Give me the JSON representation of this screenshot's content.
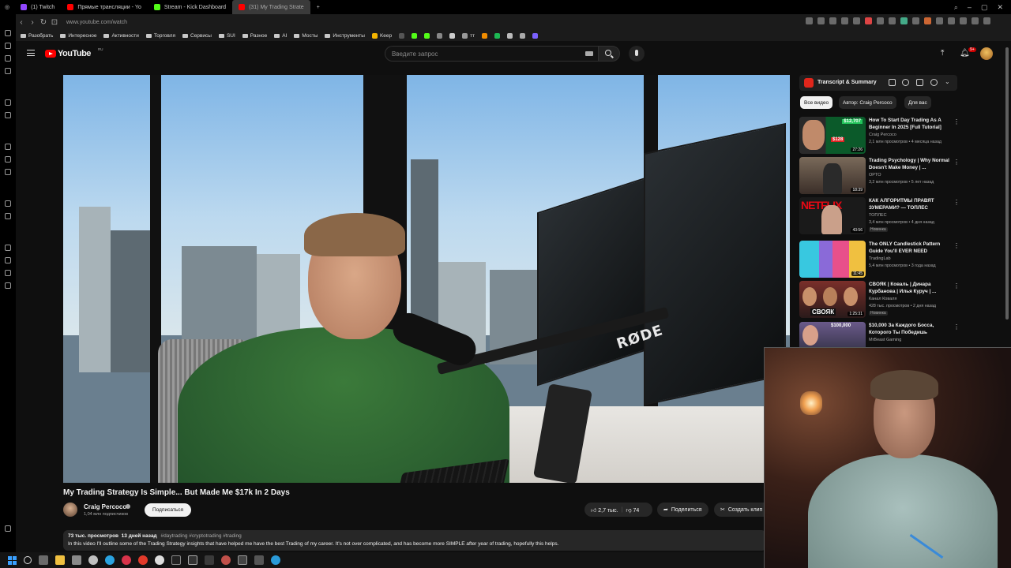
{
  "browser": {
    "tabs": [
      {
        "label": "(1) Twitch",
        "color": "#9146ff",
        "active": false
      },
      {
        "label": "Прямые трансляции - Yo",
        "color": "#ff0000",
        "active": false
      },
      {
        "label": "Stream - Kick Dashboard",
        "color": "#53fc18",
        "active": false
      },
      {
        "label": "(31) My Trading Strate",
        "color": "#ff0000",
        "active": true
      }
    ],
    "url": "www.youtube.com/watch",
    "bookmarks": [
      "Разобрать",
      "Интересное",
      "Активности",
      "Торговля",
      "Сервисы",
      "SUI",
      "Разное",
      "AI",
      "Мосты",
      "Инструменты",
      "Keep",
      "тт"
    ]
  },
  "youtube": {
    "brand": "YouTube",
    "region": "RU",
    "search_placeholder": "Введите запрос",
    "notifications": "9+"
  },
  "video": {
    "title": "My Trading Strategy Is Simple... But Made Me $17k In 2 Days",
    "channel": "Craig Percoco",
    "subscribers": "1,04 млн подписчиков",
    "subscribe_label": "Подписаться",
    "likes": "2,7 тыс.",
    "dislikes": "74",
    "share_label": "Поделиться",
    "clip_label": "Создать клип",
    "views": "73 тыс. просмотров",
    "age": "13 дней назад",
    "tags": "#daytrading #cryptotrading #trading",
    "description": "In this video I'll outline some of the Trading Strategy insights that have helped me have the best Trading of my career. It's not over complicated, and has become more SIMPLE after year of trading, hopefully this helps.",
    "overlay_text": "RØDE"
  },
  "sidebar_panel": {
    "transcript_label": "Transcript & Summary",
    "chips": [
      "Все видео",
      "Автор: Craig Percoco",
      "Для вас"
    ],
    "recommendations": [
      {
        "title": "How To Start Day Trading As A Beginner In 2025 [Full Tutorial]",
        "channel": "Craig Percoco",
        "meta": "2,1 млн просмотров • 4 месяца назад",
        "duration": "27:26",
        "badge": "",
        "thumb_overlay": "$12,707",
        "thumb_overlay2": "$128"
      },
      {
        "title": "Trading Psychology | Why Normal Doesn't Make Money | ...",
        "channel": "OPTO",
        "meta": "3,2 млн просмотров • 5 лет назад",
        "duration": "18:39",
        "badge": "",
        "thumb_overlay": "",
        "thumb_overlay2": ""
      },
      {
        "title": "КАК АЛГОРИТМЫ ПРАВЯТ ЗУМЕРАМИ? — ТОПЛЕС",
        "channel": "ТОПЛЕС",
        "meta": "3,4 млн просмотров • 4 дня назад",
        "duration": "43:56",
        "badge": "Новинка",
        "thumb_overlay": "NETFLIX",
        "thumb_overlay2": ""
      },
      {
        "title": "The ONLY Candlestick Pattern Guide You'll EVER NEED",
        "channel": "TradingLab",
        "meta": "5,4 млн просмотров • 3 года назад",
        "duration": "11:45",
        "badge": "",
        "thumb_overlay": "",
        "thumb_overlay2": ""
      },
      {
        "title": "СВОЯК | Коваль | Динара Курбанова | Илья Куруч | ...",
        "channel": "Канал Коваля",
        "meta": "428 тыс. просмотров • 2 дня назад",
        "duration": "1:25:31",
        "badge": "Новинка",
        "thumb_overlay": "СВОЯК",
        "thumb_overlay2": ""
      },
      {
        "title": "$10,000 За Каждого Босса, Которого Ты Победишь",
        "channel": "MrBeast Gaming",
        "meta": "",
        "duration": "",
        "badge": "",
        "thumb_overlay": "$100,000",
        "thumb_overlay2": ""
      }
    ]
  },
  "colors": {
    "youtube_red": "#ff0000",
    "bg": "#0f0f0f"
  }
}
